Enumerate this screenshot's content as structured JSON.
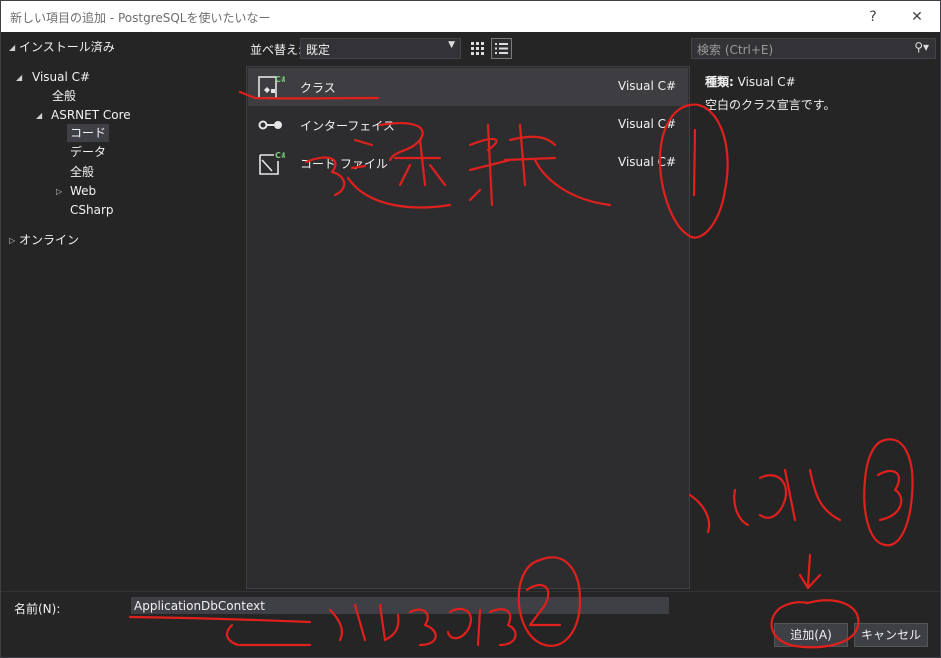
{
  "window": {
    "title": "新しい項目の追加 - PostgreSQLを使いたいなー",
    "help": "?",
    "close": "✕"
  },
  "tree": {
    "installed": "インストール済み",
    "visual_csharp": "Visual C#",
    "all": "全般",
    "aspnet_core": "ASRNET Core",
    "code": "コード",
    "data": "データ",
    "all2": "全般",
    "web": "Web",
    "csharp": "CSharp",
    "online": "オンライン"
  },
  "toolbar": {
    "sort_label": "並べ替え:",
    "sort_value": "既定"
  },
  "templates": [
    {
      "name": "クラス",
      "lang": "Visual C#",
      "icon": "class-icon",
      "selected": true
    },
    {
      "name": "インターフェイス",
      "lang": "Visual C#",
      "icon": "interface-icon",
      "selected": false
    },
    {
      "name": "コード ファイル",
      "lang": "Visual C#",
      "icon": "code-file-icon",
      "selected": false
    }
  ],
  "search": {
    "placeholder": "検索 (Ctrl+E)"
  },
  "details": {
    "type_label": "種類:",
    "type_value": "Visual C#",
    "description": "空白のクラス宣言です。"
  },
  "name_field": {
    "label": "名前(N):",
    "value": "ApplicationDbContext"
  },
  "buttons": {
    "add": "追加(A)",
    "cancel": "キャンセル"
  },
  "annotations": {
    "color": "#e0201c"
  }
}
